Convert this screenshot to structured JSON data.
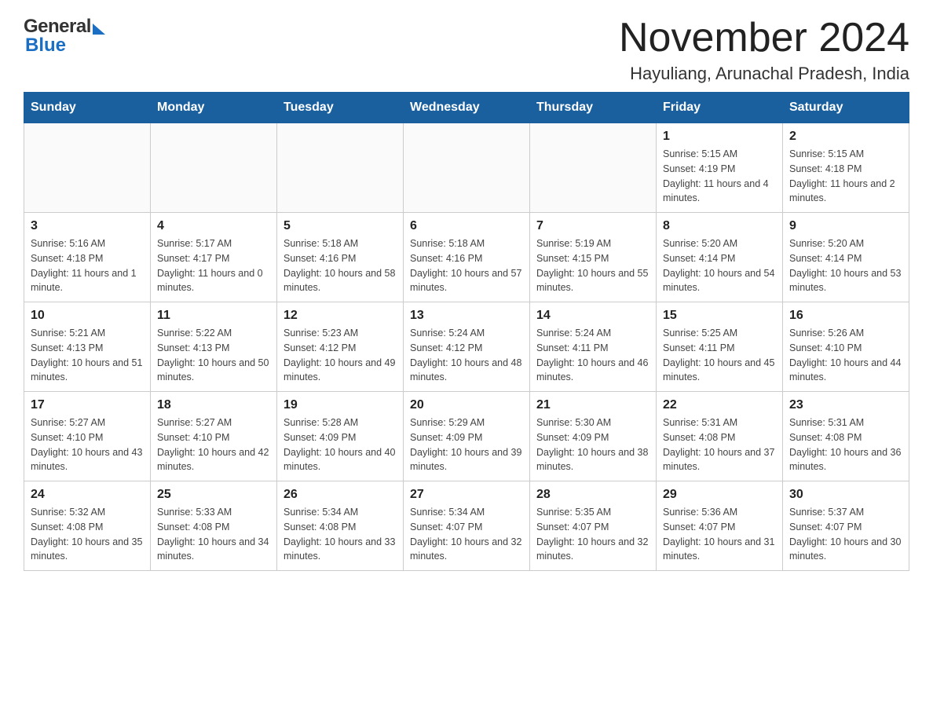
{
  "header": {
    "logo_general": "General",
    "logo_blue": "Blue",
    "title": "November 2024",
    "subtitle": "Hayuliang, Arunachal Pradesh, India"
  },
  "calendar": {
    "days_of_week": [
      "Sunday",
      "Monday",
      "Tuesday",
      "Wednesday",
      "Thursday",
      "Friday",
      "Saturday"
    ],
    "weeks": [
      [
        {
          "day": "",
          "info": ""
        },
        {
          "day": "",
          "info": ""
        },
        {
          "day": "",
          "info": ""
        },
        {
          "day": "",
          "info": ""
        },
        {
          "day": "",
          "info": ""
        },
        {
          "day": "1",
          "info": "Sunrise: 5:15 AM\nSunset: 4:19 PM\nDaylight: 11 hours and 4 minutes."
        },
        {
          "day": "2",
          "info": "Sunrise: 5:15 AM\nSunset: 4:18 PM\nDaylight: 11 hours and 2 minutes."
        }
      ],
      [
        {
          "day": "3",
          "info": "Sunrise: 5:16 AM\nSunset: 4:18 PM\nDaylight: 11 hours and 1 minute."
        },
        {
          "day": "4",
          "info": "Sunrise: 5:17 AM\nSunset: 4:17 PM\nDaylight: 11 hours and 0 minutes."
        },
        {
          "day": "5",
          "info": "Sunrise: 5:18 AM\nSunset: 4:16 PM\nDaylight: 10 hours and 58 minutes."
        },
        {
          "day": "6",
          "info": "Sunrise: 5:18 AM\nSunset: 4:16 PM\nDaylight: 10 hours and 57 minutes."
        },
        {
          "day": "7",
          "info": "Sunrise: 5:19 AM\nSunset: 4:15 PM\nDaylight: 10 hours and 55 minutes."
        },
        {
          "day": "8",
          "info": "Sunrise: 5:20 AM\nSunset: 4:14 PM\nDaylight: 10 hours and 54 minutes."
        },
        {
          "day": "9",
          "info": "Sunrise: 5:20 AM\nSunset: 4:14 PM\nDaylight: 10 hours and 53 minutes."
        }
      ],
      [
        {
          "day": "10",
          "info": "Sunrise: 5:21 AM\nSunset: 4:13 PM\nDaylight: 10 hours and 51 minutes."
        },
        {
          "day": "11",
          "info": "Sunrise: 5:22 AM\nSunset: 4:13 PM\nDaylight: 10 hours and 50 minutes."
        },
        {
          "day": "12",
          "info": "Sunrise: 5:23 AM\nSunset: 4:12 PM\nDaylight: 10 hours and 49 minutes."
        },
        {
          "day": "13",
          "info": "Sunrise: 5:24 AM\nSunset: 4:12 PM\nDaylight: 10 hours and 48 minutes."
        },
        {
          "day": "14",
          "info": "Sunrise: 5:24 AM\nSunset: 4:11 PM\nDaylight: 10 hours and 46 minutes."
        },
        {
          "day": "15",
          "info": "Sunrise: 5:25 AM\nSunset: 4:11 PM\nDaylight: 10 hours and 45 minutes."
        },
        {
          "day": "16",
          "info": "Sunrise: 5:26 AM\nSunset: 4:10 PM\nDaylight: 10 hours and 44 minutes."
        }
      ],
      [
        {
          "day": "17",
          "info": "Sunrise: 5:27 AM\nSunset: 4:10 PM\nDaylight: 10 hours and 43 minutes."
        },
        {
          "day": "18",
          "info": "Sunrise: 5:27 AM\nSunset: 4:10 PM\nDaylight: 10 hours and 42 minutes."
        },
        {
          "day": "19",
          "info": "Sunrise: 5:28 AM\nSunset: 4:09 PM\nDaylight: 10 hours and 40 minutes."
        },
        {
          "day": "20",
          "info": "Sunrise: 5:29 AM\nSunset: 4:09 PM\nDaylight: 10 hours and 39 minutes."
        },
        {
          "day": "21",
          "info": "Sunrise: 5:30 AM\nSunset: 4:09 PM\nDaylight: 10 hours and 38 minutes."
        },
        {
          "day": "22",
          "info": "Sunrise: 5:31 AM\nSunset: 4:08 PM\nDaylight: 10 hours and 37 minutes."
        },
        {
          "day": "23",
          "info": "Sunrise: 5:31 AM\nSunset: 4:08 PM\nDaylight: 10 hours and 36 minutes."
        }
      ],
      [
        {
          "day": "24",
          "info": "Sunrise: 5:32 AM\nSunset: 4:08 PM\nDaylight: 10 hours and 35 minutes."
        },
        {
          "day": "25",
          "info": "Sunrise: 5:33 AM\nSunset: 4:08 PM\nDaylight: 10 hours and 34 minutes."
        },
        {
          "day": "26",
          "info": "Sunrise: 5:34 AM\nSunset: 4:08 PM\nDaylight: 10 hours and 33 minutes."
        },
        {
          "day": "27",
          "info": "Sunrise: 5:34 AM\nSunset: 4:07 PM\nDaylight: 10 hours and 32 minutes."
        },
        {
          "day": "28",
          "info": "Sunrise: 5:35 AM\nSunset: 4:07 PM\nDaylight: 10 hours and 32 minutes."
        },
        {
          "day": "29",
          "info": "Sunrise: 5:36 AM\nSunset: 4:07 PM\nDaylight: 10 hours and 31 minutes."
        },
        {
          "day": "30",
          "info": "Sunrise: 5:37 AM\nSunset: 4:07 PM\nDaylight: 10 hours and 30 minutes."
        }
      ]
    ]
  }
}
